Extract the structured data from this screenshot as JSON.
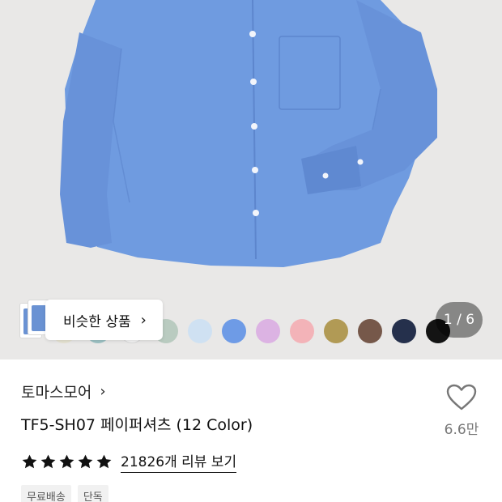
{
  "product_image": {
    "alt_icon": "blue-shirt-photo"
  },
  "similar": {
    "label": "비슷한 상품",
    "chevron": "›"
  },
  "swatches": [
    {
      "color": "#e6e3d2"
    },
    {
      "color": "#9dc2c4"
    },
    {
      "color": "#f4f4f4"
    },
    {
      "color": "#b9cbc0"
    },
    {
      "color": "#cfe1f2"
    },
    {
      "color": "#6e9be6"
    },
    {
      "color": "#dcb3e3"
    },
    {
      "color": "#f3b3b8"
    },
    {
      "color": "#b19a55"
    },
    {
      "color": "#76584a"
    },
    {
      "color": "#25304c"
    },
    {
      "color": "#141414"
    }
  ],
  "pager": {
    "text": "1 / 6"
  },
  "brand": {
    "name": "토마스모어",
    "chevron": "›"
  },
  "product": {
    "title": "TF5-SH07 페이퍼셔츠 (12 Color)"
  },
  "like": {
    "icon": "heart-outline-icon",
    "count": "6.6만"
  },
  "rating": {
    "stars": 5,
    "review_label": "21826개 리뷰 보기"
  },
  "badges": [
    "무료배송",
    "단독"
  ],
  "colors": {
    "shirt": "#6f9be0",
    "background": "#e9e8e7",
    "star": "#111111"
  }
}
